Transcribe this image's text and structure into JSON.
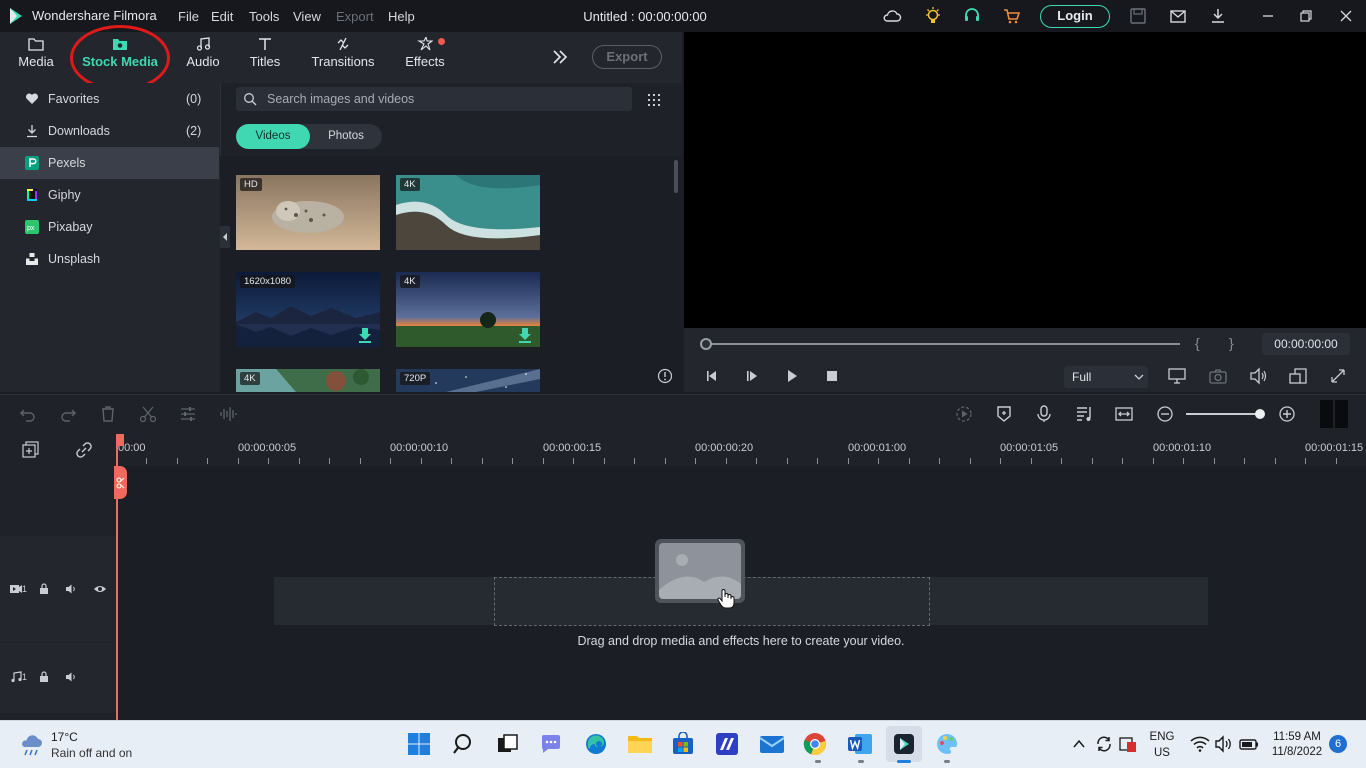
{
  "titlebar": {
    "app_name": "Wondershare Filmora",
    "menu": [
      "File",
      "Edit",
      "Tools",
      "View",
      "Export",
      "Help"
    ],
    "doc_title": "Untitled : 00:00:00:00",
    "login_label": "Login"
  },
  "library": {
    "tabs": [
      {
        "label": "Media",
        "icon": "folder-icon"
      },
      {
        "label": "Stock Media",
        "icon": "stock-media-icon",
        "active": true
      },
      {
        "label": "Audio",
        "icon": "music-note-icon"
      },
      {
        "label": "Titles",
        "icon": "text-t-icon"
      },
      {
        "label": "Transitions",
        "icon": "transition-icon"
      },
      {
        "label": "Effects",
        "icon": "effects-star-icon"
      }
    ],
    "export_label": "Export",
    "sidebar": [
      {
        "label": "Favorites",
        "count": "(0)",
        "icon": "heart-icon"
      },
      {
        "label": "Downloads",
        "count": "(2)",
        "icon": "download-icon"
      },
      {
        "label": "Pexels",
        "count": "",
        "icon": "pexels-icon",
        "selected": true
      },
      {
        "label": "Giphy",
        "count": "",
        "icon": "giphy-icon"
      },
      {
        "label": "Pixabay",
        "count": "",
        "icon": "pixabay-icon"
      },
      {
        "label": "Unsplash",
        "count": "",
        "icon": "unsplash-icon"
      }
    ],
    "search_placeholder": "Search images and videos",
    "segments": [
      "Videos",
      "Photos"
    ],
    "thumbnails": [
      {
        "badge": "HD",
        "scene": "seal on beach",
        "downloaded": false
      },
      {
        "badge": "4K",
        "scene": "aerial ocean waves",
        "downloaded": false
      },
      {
        "badge": "1620x1080",
        "scene": "night mountain lake",
        "downloaded": true
      },
      {
        "badge": "4K",
        "scene": "sunset field tree",
        "downloaded": true
      },
      {
        "badge": "4K",
        "scene": "aerial coast",
        "downloaded": false
      },
      {
        "badge": "720P",
        "scene": "starry sky",
        "downloaded": false
      }
    ]
  },
  "preview": {
    "timecode": "00:00:00:00",
    "quality": "Full",
    "bracket_in": "{",
    "bracket_out": "}"
  },
  "timeline": {
    "ruler_labels": [
      "00:00",
      "00:00:00:05",
      "00:00:00:10",
      "00:00:00:15",
      "00:00:00:20",
      "00:00:01:00",
      "00:00:01:05",
      "00:00:01:10",
      "00:00:01:15"
    ],
    "video_track": "1",
    "audio_track": "1",
    "drop_text": "Drag and drop media and effects here to create your video."
  },
  "taskbar": {
    "weather_temp": "17°C",
    "weather_desc": "Rain off and on",
    "lang_top": "ENG",
    "lang_bottom": "US",
    "time": "11:59 AM",
    "date": "11/8/2022",
    "notification_count": "6"
  },
  "colors": {
    "accent": "#3fd8b2",
    "playhead": "#f06b5e",
    "annotation_circle": "#e01919"
  }
}
